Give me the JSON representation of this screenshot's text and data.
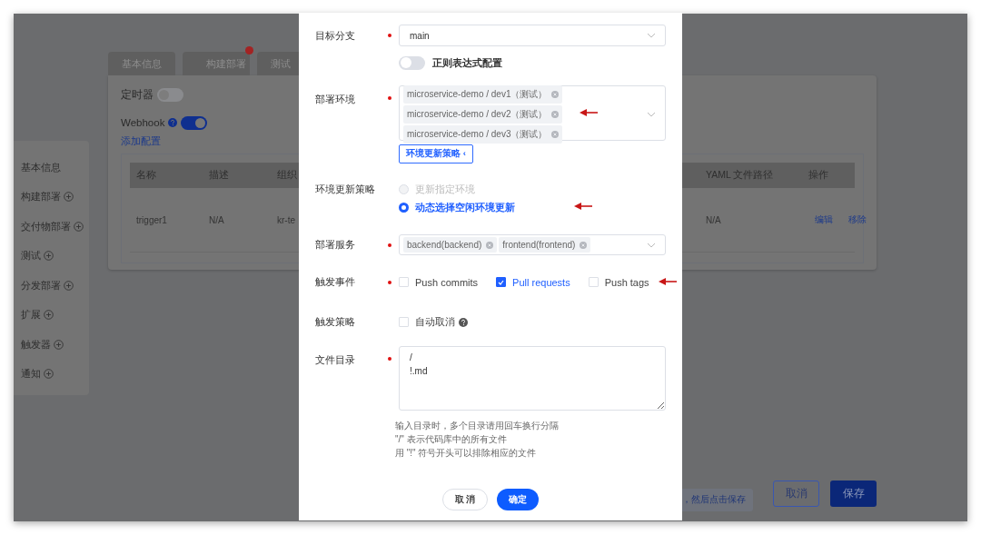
{
  "background": {
    "tabs": [
      {
        "label": "基本信息",
        "selected": false,
        "error": false
      },
      {
        "label": "构建部署",
        "selected": false,
        "error": true
      },
      {
        "label": "测试",
        "selected": false,
        "error": false
      }
    ],
    "timer": {
      "label": "定时器",
      "on": false
    },
    "webhook": {
      "label": "Webhook",
      "on": true
    },
    "add_link": "添加配置",
    "table": {
      "columns": [
        "名称",
        "描述",
        "组织",
        "YAML 文件路径",
        "操作"
      ],
      "rows": [
        {
          "cells": [
            "trigger1",
            "N/A",
            "kr-te",
            "N/A"
          ],
          "actions": [
            "编辑",
            "移除"
          ]
        }
      ]
    },
    "sidebar": {
      "items": [
        {
          "label": "基本信息",
          "kind": "plain"
        },
        {
          "label": "构建部署",
          "kind": "addable"
        },
        {
          "label": "交付物部署",
          "kind": "addable"
        },
        {
          "label": "测试",
          "kind": "addable"
        },
        {
          "label": "分发部署",
          "kind": "addable"
        },
        {
          "label": "扩展",
          "kind": "addable"
        },
        {
          "label": "触发器",
          "kind": "addable"
        },
        {
          "label": "通知",
          "kind": "addable"
        }
      ]
    },
    "hint": "，然后点击保存",
    "buttons": [
      {
        "label": "取消",
        "kind": "secondary"
      },
      {
        "label": "保存",
        "kind": "primary"
      }
    ]
  },
  "dialog": {
    "target_branch": {
      "label": "目标分支",
      "required": true,
      "value": "main"
    },
    "regex": {
      "label": "正则表达式配置",
      "on": false
    },
    "deploy_env": {
      "label": "部署环境",
      "required": true,
      "tags": [
        "microservice-demo / dev1（测试）",
        "microservice-demo / dev2（测试）",
        "microservice-demo / dev3（测试）"
      ],
      "strategy_button": "环境更新策略 ‹"
    },
    "env_strategy": {
      "label": "环境更新策略",
      "options": [
        {
          "label": "更新指定环境",
          "selected": false,
          "disabled": true
        },
        {
          "label": "动态选择空闲环境更新",
          "selected": true,
          "disabled": false
        }
      ]
    },
    "deploy_service": {
      "label": "部署服务",
      "required": true,
      "tags": [
        "backend(backend)",
        "frontend(frontend)"
      ]
    },
    "trigger_events": {
      "label": "触发事件",
      "required": true,
      "options": [
        {
          "label": "Push commits",
          "checked": false
        },
        {
          "label": "Pull requests",
          "checked": true
        },
        {
          "label": "Push tags",
          "checked": false
        }
      ]
    },
    "trigger_strategy": {
      "label": "触发策略",
      "options": [
        {
          "label": "自动取消",
          "checked": false
        }
      ]
    },
    "file_dir": {
      "label": "文件目录",
      "required": true,
      "value": "/\n!.md",
      "help": [
        "输入目录时，多个目录请用回车换行分隔",
        "\"/\" 表示代码库中的所有文件",
        "用 \"!\" 符号开头可以排除相应的文件"
      ]
    },
    "buttons": [
      {
        "label": "取 消",
        "kind": "secondary"
      },
      {
        "label": "确定",
        "kind": "primary"
      }
    ]
  }
}
